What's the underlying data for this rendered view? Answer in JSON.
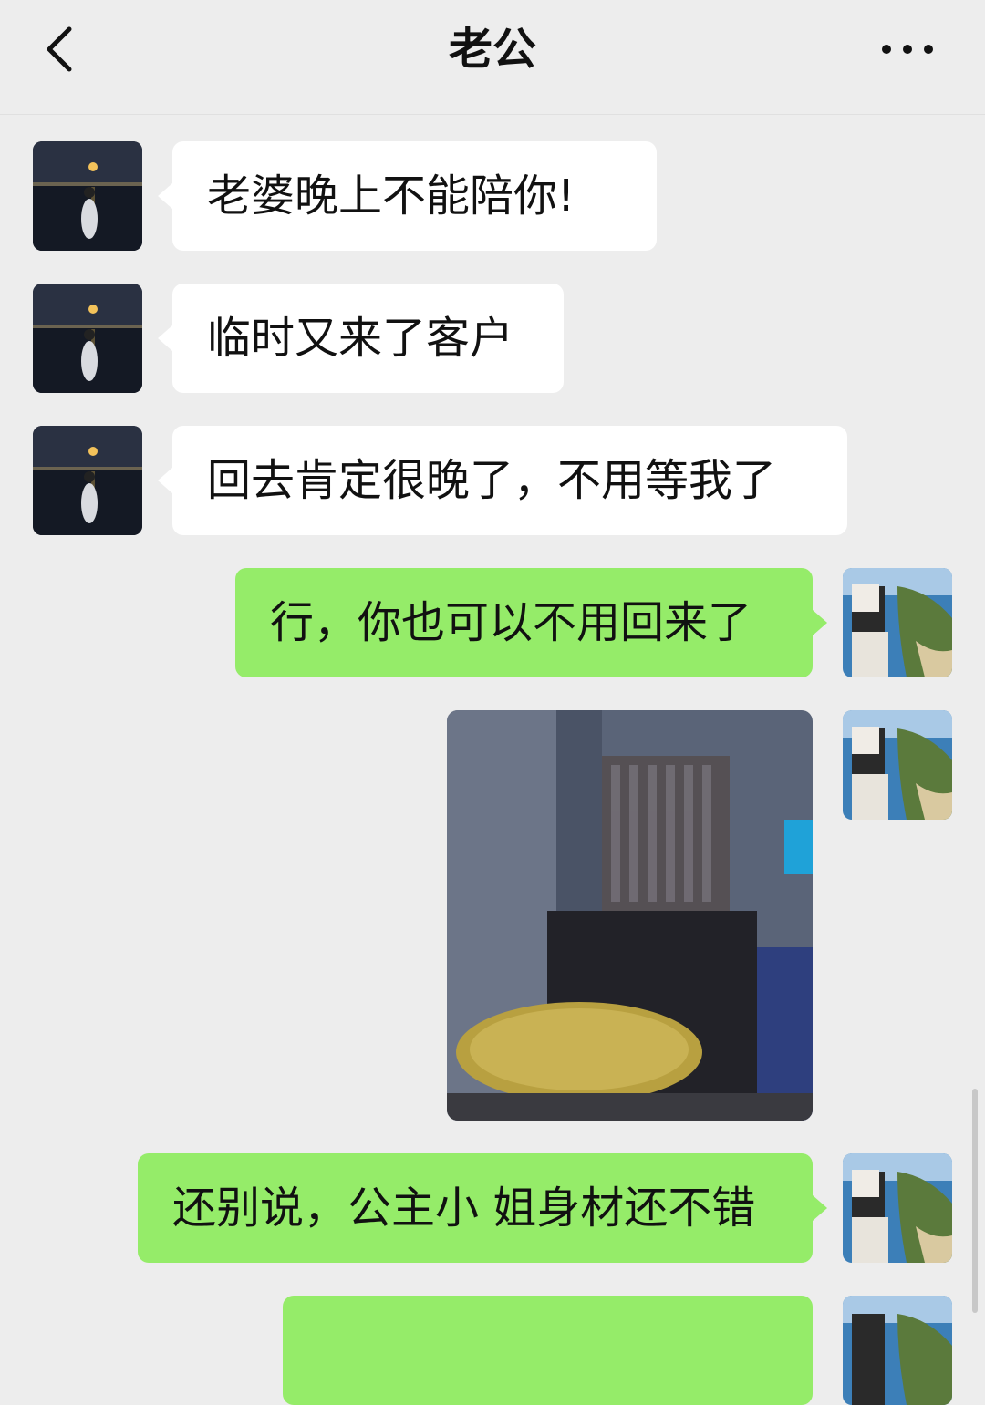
{
  "header": {
    "title": "老公",
    "back_icon": "chevron-left-icon",
    "more_icon": "more-dots-icon"
  },
  "messages": [
    {
      "side": "in",
      "text": "老婆晚上不能陪你!"
    },
    {
      "side": "in",
      "text": "临时又来了客户"
    },
    {
      "side": "in",
      "text": "回去肯定很晚了，不用等我了"
    },
    {
      "side": "out",
      "text": "行，你也可以不用回来了"
    },
    {
      "side": "out",
      "type": "image"
    },
    {
      "side": "out",
      "text": "还别说，公主小 姐身材还不错"
    },
    {
      "side": "out",
      "text": ""
    }
  ],
  "colors": {
    "background": "#ededed",
    "incoming_bubble": "#ffffff",
    "outgoing_bubble": "#95ec69"
  }
}
